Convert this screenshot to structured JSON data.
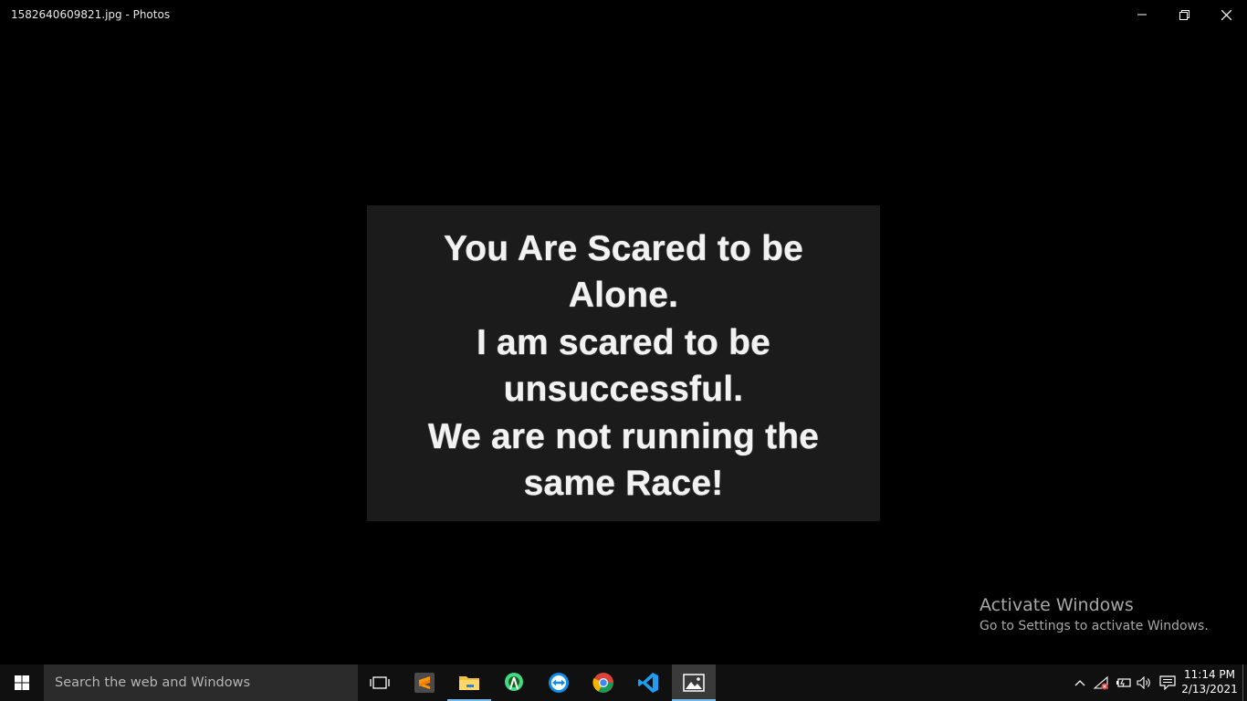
{
  "window": {
    "title": "1582640609821.jpg - Photos",
    "buttons": {
      "minimize": "minimize-icon",
      "restore": "restore-icon",
      "close": "close-icon"
    }
  },
  "photo": {
    "lines": [
      "You Are Scared to be",
      "Alone.",
      "I am scared to be",
      "unsuccessful.",
      "We are not running the",
      "same Race!"
    ]
  },
  "watermark": {
    "title": "Activate Windows",
    "subtitle": "Go to Settings to activate Windows."
  },
  "taskbar": {
    "search_placeholder": "Search the web and Windows",
    "apps": [
      "task-view",
      "sublime-text",
      "file-explorer",
      "android-studio",
      "teamviewer",
      "chrome",
      "vscode",
      "photos"
    ],
    "clock": {
      "time": "11:14 PM",
      "date": "2/13/2021"
    },
    "accent": "#76b9ed"
  }
}
